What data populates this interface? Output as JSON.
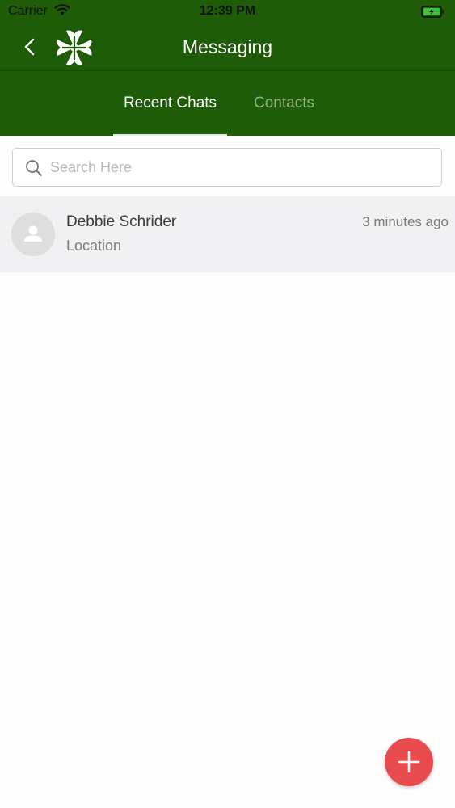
{
  "status_bar": {
    "carrier": "Carrier",
    "time": "12:39 PM",
    "wifi_icon": "wifi-icon",
    "battery_icon": "battery-charging-icon"
  },
  "nav": {
    "title": "Messaging",
    "back_icon": "chevron-left-icon",
    "logo_icon": "clover-logo"
  },
  "tabs": [
    {
      "label": "Recent Chats",
      "active": true
    },
    {
      "label": "Contacts",
      "active": false
    }
  ],
  "search": {
    "placeholder": "Search Here",
    "icon": "search-icon"
  },
  "chats": [
    {
      "name": "Debbie Schrider",
      "preview": "Location",
      "time": "3 minutes ago",
      "avatar_icon": "person-icon"
    }
  ],
  "fab": {
    "icon": "plus-icon",
    "color": "#ea4b4f"
  },
  "colors": {
    "header_green": "#1e5c08",
    "tab_inactive": "#8fb587",
    "row_background": "#f1f0f2"
  }
}
